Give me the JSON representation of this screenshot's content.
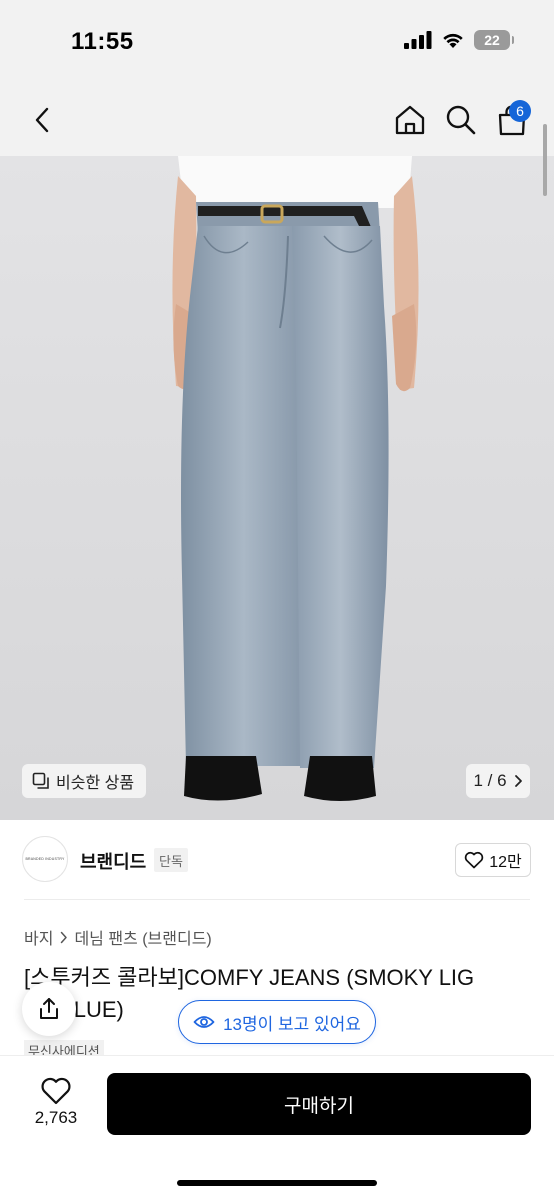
{
  "status_bar": {
    "time": "11:55",
    "battery": "22"
  },
  "nav": {
    "back_icon": "chevron-left-icon",
    "home_icon": "home-icon",
    "search_icon": "search-icon",
    "cart_icon": "shopping-bag-icon",
    "cart_badge": "6",
    "badge_color": "#1565d8"
  },
  "image_overlay": {
    "similar_label": "비슷한 상품",
    "counter": "1 / 6"
  },
  "brand": {
    "logo_text": "BRANDED INDUSTRY",
    "name": "브랜디드",
    "tag": "단독",
    "likes": "12만"
  },
  "breadcrumb": {
    "items": [
      "바지",
      "데님 팬츠 (브랜디드)"
    ]
  },
  "product": {
    "title_line1": "[스투커즈 콜라보]COMFY JEANS (SMOKY LIG",
    "title_line2": "HT BLUE)",
    "edition_tag": "무신사에디션"
  },
  "watching": {
    "label": "13명이 보고 있어요",
    "accent": "#1f66e0"
  },
  "bottom_bar": {
    "wish_count": "2,763",
    "buy_label": "구매하기"
  }
}
